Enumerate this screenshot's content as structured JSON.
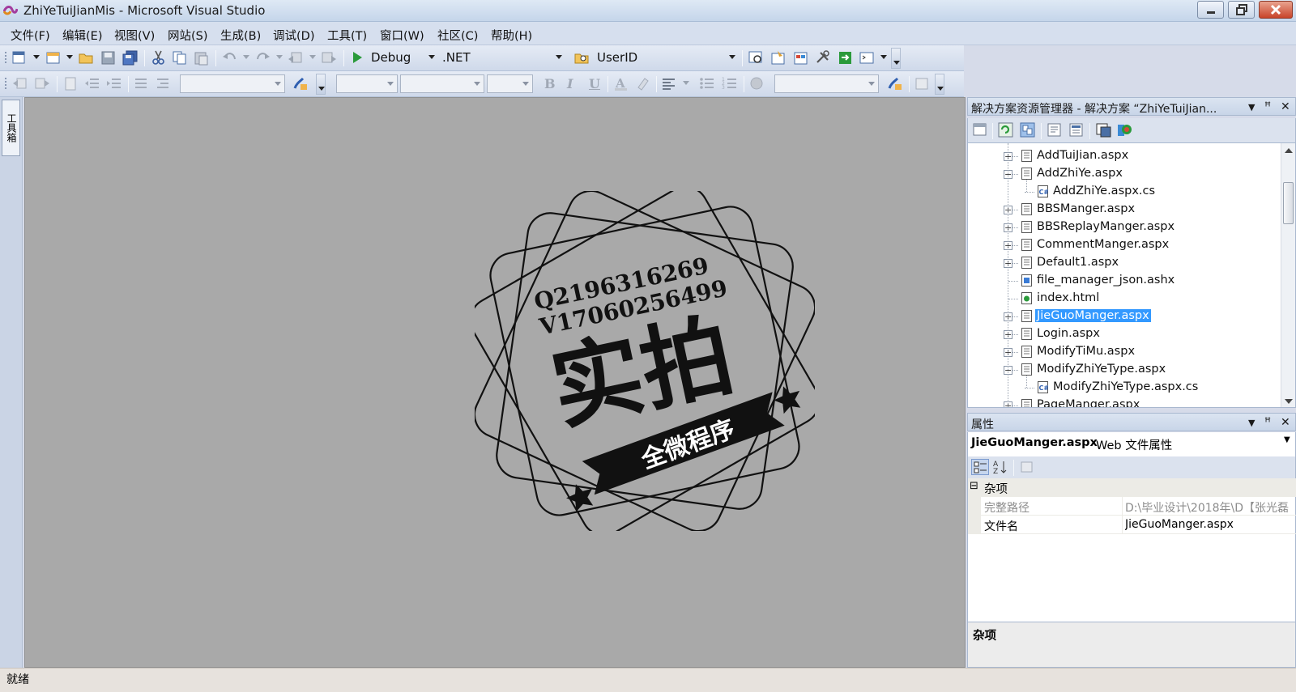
{
  "window": {
    "title": "ZhiYeTuiJianMis - Microsoft Visual Studio"
  },
  "menu": [
    "文件(F)",
    "编辑(E)",
    "视图(V)",
    "网站(S)",
    "生成(B)",
    "调试(D)",
    "工具(T)",
    "窗口(W)",
    "社区(C)",
    "帮助(H)"
  ],
  "toolbar": {
    "config": "Debug",
    "platform": ".NET",
    "find_target": "UserID"
  },
  "toolbox": {
    "tab_label": "工具箱"
  },
  "editor": {
    "watermark": {
      "line1": "Q2196316269",
      "line2": "V17060256499",
      "main": "实拍",
      "banner": "全微程序"
    }
  },
  "solution_explorer": {
    "title": "解决方案资源管理器 - 解决方案 “ZhiYeTuiJian...",
    "items": [
      {
        "label": "AddTuiJian.aspx",
        "expander": "+"
      },
      {
        "label": "AddZhiYe.aspx",
        "expander": "−"
      },
      {
        "label": "AddZhiYe.aspx.cs",
        "expander": ""
      },
      {
        "label": "BBSManger.aspx",
        "expander": "+"
      },
      {
        "label": "BBSReplayManger.aspx",
        "expander": "+"
      },
      {
        "label": "CommentManger.aspx",
        "expander": "+"
      },
      {
        "label": "Default1.aspx",
        "expander": "+"
      },
      {
        "label": "file_manager_json.ashx",
        "expander": ""
      },
      {
        "label": "index.html",
        "expander": ""
      },
      {
        "label": "JieGuoManger.aspx",
        "expander": "+",
        "selected": true
      },
      {
        "label": "Login.aspx",
        "expander": "+"
      },
      {
        "label": "ModifyTiMu.aspx",
        "expander": "+"
      },
      {
        "label": "ModifyZhiYeType.aspx",
        "expander": "−"
      },
      {
        "label": "ModifyZhiYeType.aspx.cs",
        "expander": ""
      },
      {
        "label": "PageManger.aspx",
        "expander": "+"
      }
    ]
  },
  "properties": {
    "title": "属性",
    "object_name": "JieGuoManger.aspx",
    "object_type": "Web 文件属性",
    "category": "杂项",
    "category_expander": "⊟",
    "rows": [
      {
        "name": "完整路径",
        "value": "D:\\毕业设计\\2018年\\D【张光磊",
        "readonly": true
      },
      {
        "name": "文件名",
        "value": "JieGuoManger.aspx",
        "readonly": false
      }
    ],
    "description_title": "杂项"
  },
  "status": {
    "text": "就绪"
  },
  "colors": {
    "selection": "#3399ff",
    "editor_bg": "#a9a9a9",
    "title_gradient": "#c5d5ea"
  }
}
